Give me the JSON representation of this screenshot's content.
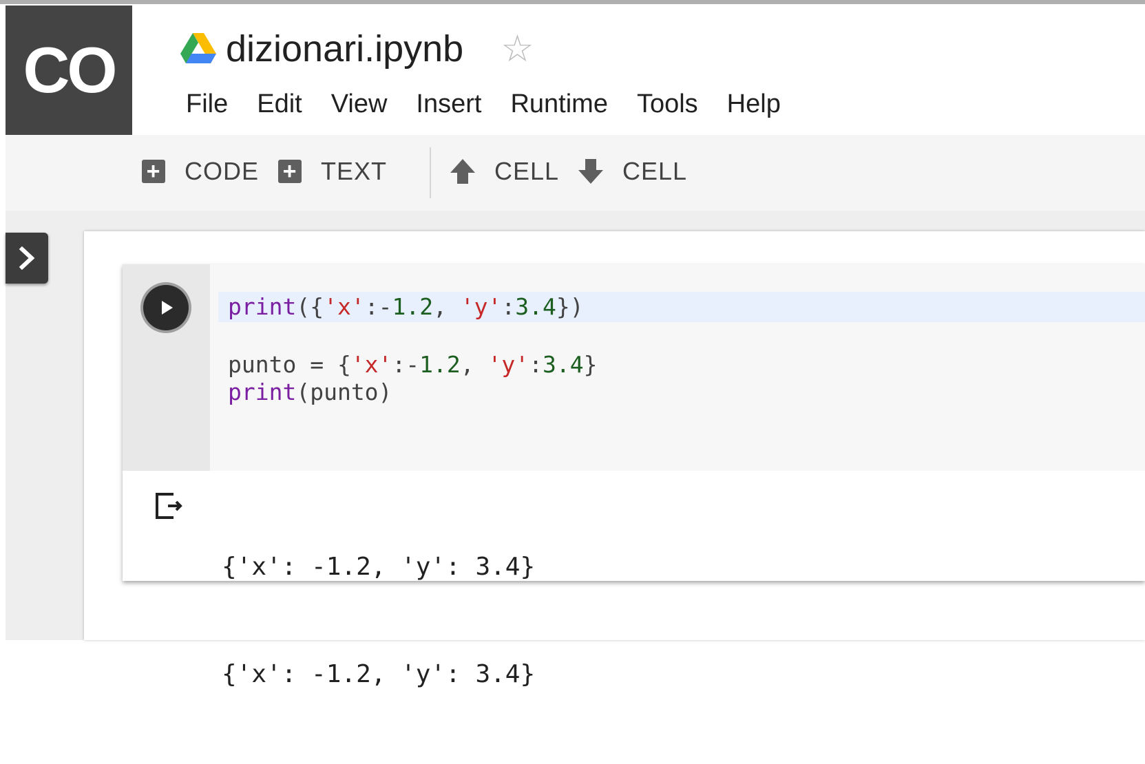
{
  "app": {
    "logo_text": "CO"
  },
  "notebook": {
    "title": "dizionari.ipynb"
  },
  "menu": [
    "File",
    "Edit",
    "View",
    "Insert",
    "Runtime",
    "Tools",
    "Help"
  ],
  "toolbar": {
    "add_code": "CODE",
    "add_text": "TEXT",
    "cell_up": "CELL",
    "cell_down": "CELL"
  },
  "cell": {
    "code_lines": [
      {
        "tokens": [
          [
            "kw",
            "print"
          ],
          [
            "pun",
            "({"
          ],
          [
            "str",
            "'x'"
          ],
          [
            "pun",
            ":-"
          ],
          [
            "num",
            "1.2"
          ],
          [
            "pun",
            ", "
          ],
          [
            "str",
            "'y'"
          ],
          [
            "pun",
            ":"
          ],
          [
            "num",
            "3.4"
          ],
          [
            "pun",
            "})"
          ]
        ]
      },
      {
        "tokens": []
      },
      {
        "tokens": [
          [
            "pun",
            "punto = {"
          ],
          [
            "str",
            "'x'"
          ],
          [
            "pun",
            ":-"
          ],
          [
            "num",
            "1.2"
          ],
          [
            "pun",
            ", "
          ],
          [
            "str",
            "'y'"
          ],
          [
            "pun",
            ":"
          ],
          [
            "num",
            "3.4"
          ],
          [
            "pun",
            "}"
          ]
        ]
      },
      {
        "tokens": [
          [
            "kw",
            "print"
          ],
          [
            "pun",
            "(punto)"
          ]
        ]
      }
    ],
    "output_lines": [
      "{'x': -1.2, 'y': 3.4}",
      "{'x': -1.2, 'y': 3.4}"
    ]
  },
  "icons": {
    "logo": "colab-logo",
    "title": "google-drive-icon",
    "star": "star-outline-icon",
    "sidebar": "chevron-right-icon",
    "run": "play-icon",
    "output": "output-icon"
  },
  "colors": {
    "logo_bg": "#444444",
    "keyword": "#7b1fa2",
    "string": "#c62828",
    "number": "#1b5e20",
    "active_line": "#e8f0fe"
  }
}
